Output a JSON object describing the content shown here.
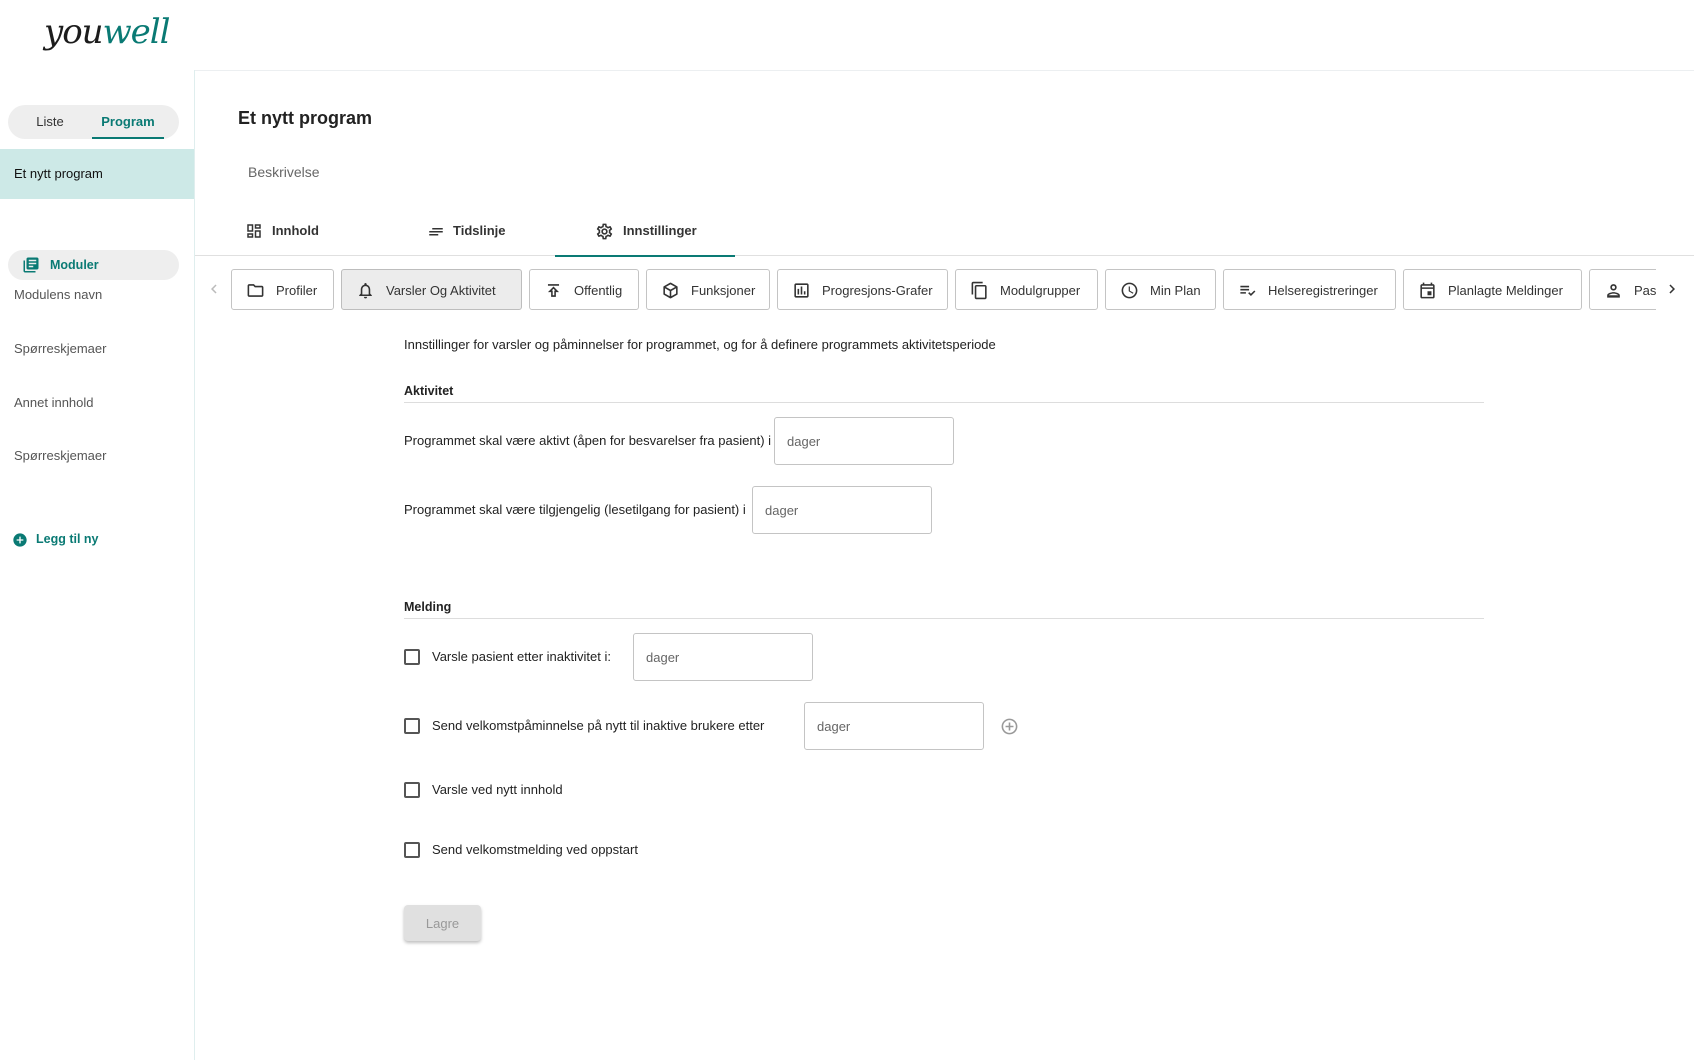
{
  "logo": {
    "part1": "you",
    "part2": "well"
  },
  "sidebar": {
    "toggle": {
      "liste": "Liste",
      "program": "Program"
    },
    "selected_program": "Et nytt program",
    "moduler": "Moduler",
    "items": [
      "Modulens navn",
      "Spørreskjemaer",
      "Annet innhold",
      "Spørreskjemaer"
    ],
    "add_new": "Legg til ny"
  },
  "main": {
    "title": "Et nytt program",
    "description_label": "Beskrivelse",
    "tabs": [
      {
        "label": "Innhold",
        "icon": "dashboard-icon"
      },
      {
        "label": "Tidslinje",
        "icon": "lines-icon"
      },
      {
        "label": "Innstillinger",
        "icon": "gear-icon",
        "active": true
      }
    ],
    "chips": [
      {
        "label": "Profiler",
        "icon": "folder-icon"
      },
      {
        "label": "Varsler Og Aktivitet",
        "icon": "bell-icon",
        "active": true
      },
      {
        "label": "Offentlig",
        "icon": "publish-icon"
      },
      {
        "label": "Funksjoner",
        "icon": "cube-icon"
      },
      {
        "label": "Progresjons-Grafer",
        "icon": "bar-chart-icon"
      },
      {
        "label": "Modulgrupper",
        "icon": "copy-icon"
      },
      {
        "label": "Min Plan",
        "icon": "clock-icon"
      },
      {
        "label": "Helseregistreringer",
        "icon": "edit-list-icon"
      },
      {
        "label": "Planlagte Meldinger",
        "icon": "calendar-icon"
      },
      {
        "label": "Pasienter",
        "icon": "person-icon"
      }
    ],
    "intro": "Innstillinger for varsler og påminnelser for programmet, og for å definere programmets aktivitetsperiode",
    "aktivitet": {
      "heading": "Aktivitet",
      "active_label": "Programmet skal være aktivt (åpen for besvarelser fra pasient) i",
      "active_placeholder": "dager",
      "available_label": "Programmet skal være tilgjengelig (lesetilgang for pasient) i",
      "available_placeholder": "dager"
    },
    "melding": {
      "heading": "Melding",
      "inactivity_label": "Varsle pasient etter inaktivitet i:",
      "inactivity_placeholder": "dager",
      "reminder_label": "Send velkomstpåminnelse på nytt til inaktive brukere etter",
      "reminder_placeholder": "dager",
      "new_content_label": "Varsle ved nytt innhold",
      "welcome_label": "Send velkomstmelding ved oppstart"
    },
    "save_label": "Lagre"
  },
  "colors": {
    "accent": "#0a7a74",
    "selected_bg": "#cde9e7"
  }
}
